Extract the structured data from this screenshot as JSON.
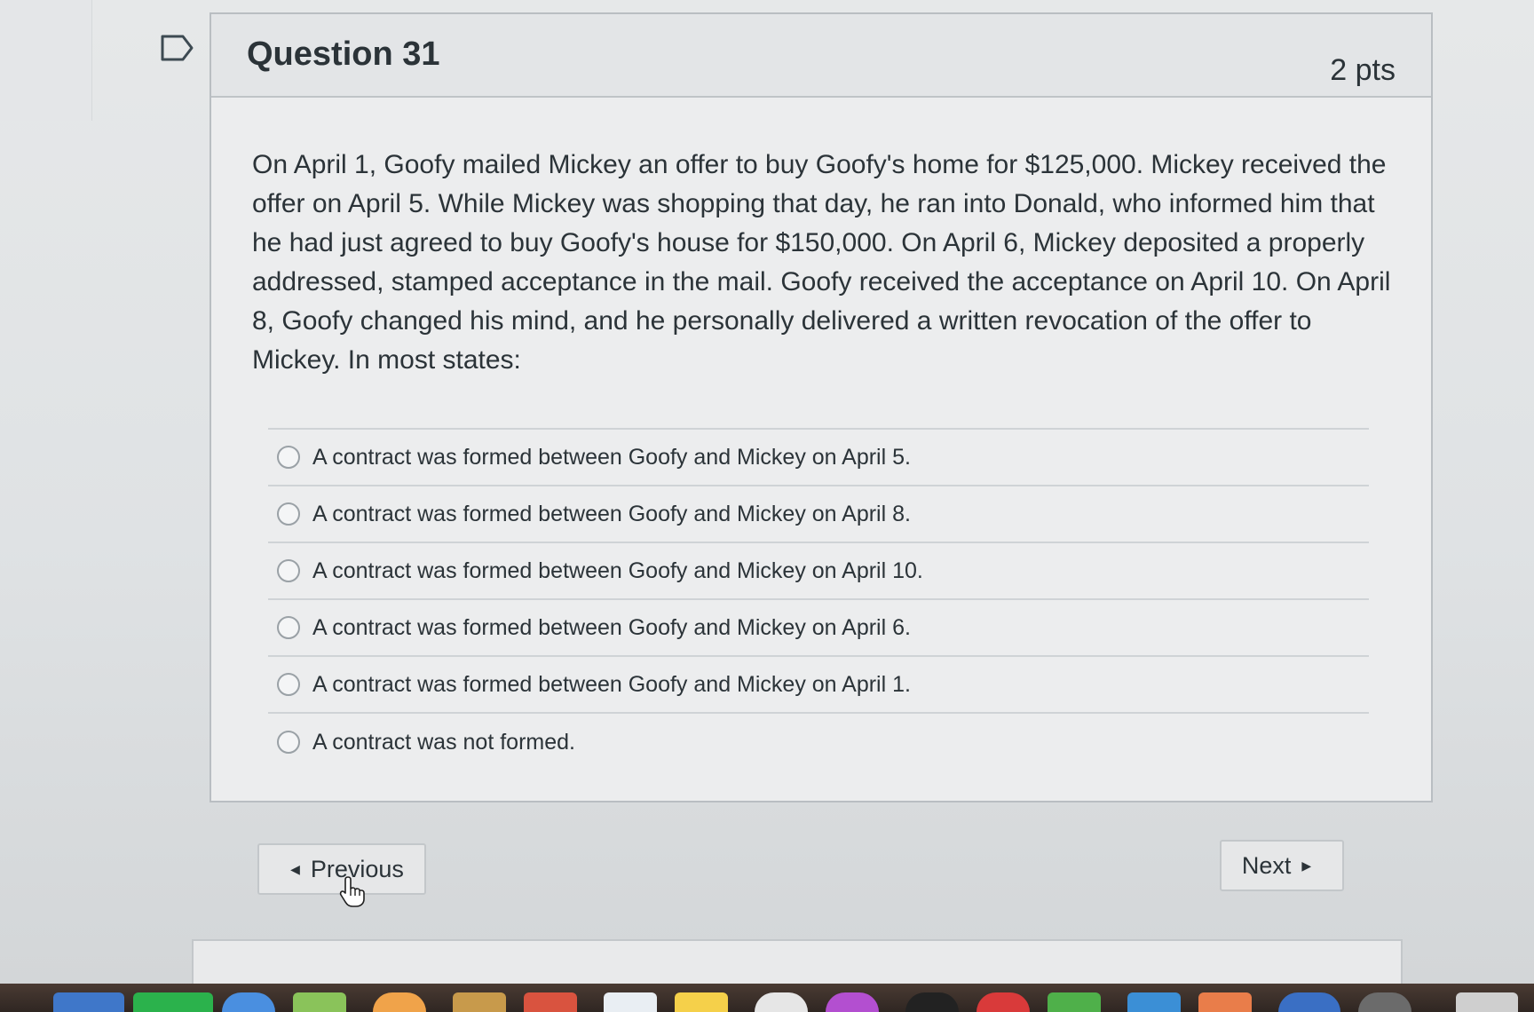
{
  "question": {
    "title": "Question 31",
    "points": "2 pts",
    "text": "On April 1, Goofy mailed Mickey an offer to buy Goofy's home for $125,000. Mickey received the offer on April 5. While Mickey was shopping that day, he ran into Donald, who informed him that he had just agreed to buy Goofy's house for $150,000.  On April 6, Mickey deposited a properly addressed, stamped acceptance in the mail. Goofy received the acceptance on April 10. On April 8, Goofy changed his mind, and he personally delivered a written revocation of the offer to Mickey. In most states:"
  },
  "answers": [
    {
      "label": "A contract was formed between Goofy and Mickey on April 5."
    },
    {
      "label": "A contract was formed between Goofy and Mickey on April 8."
    },
    {
      "label": "A contract was formed between Goofy and Mickey on April 10."
    },
    {
      "label": "A contract was formed between Goofy and Mickey on April 6."
    },
    {
      "label": "A contract was formed between Goofy and Mickey on April 1."
    },
    {
      "label": "A contract was not formed."
    }
  ],
  "navigation": {
    "previous_label": "Previous",
    "next_label": "Next"
  },
  "icons": {
    "flag": "flag-icon",
    "cursor": "hand-pointer-icon",
    "prev_arrow": "caret-left-icon",
    "next_arrow": "caret-right-icon"
  }
}
